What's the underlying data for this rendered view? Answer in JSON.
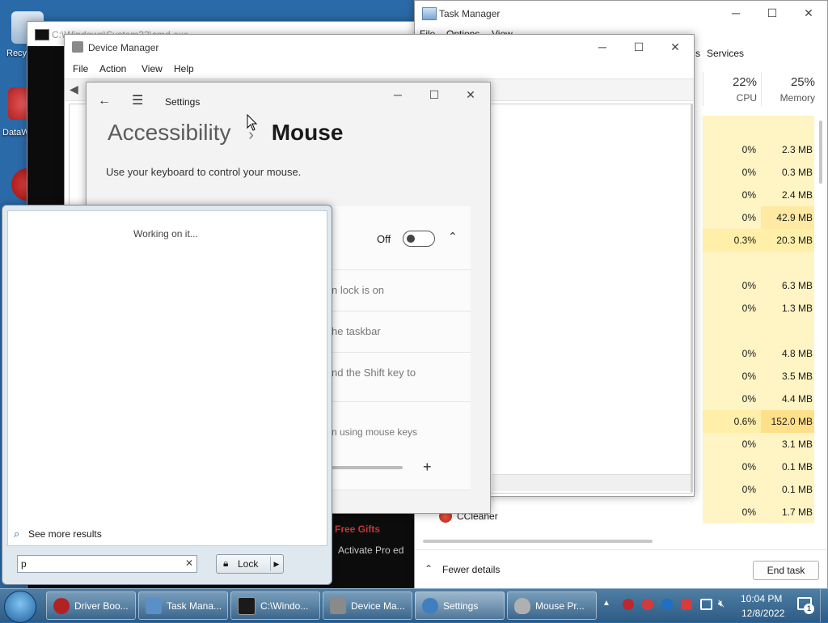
{
  "desktop": {
    "icons": [
      {
        "label": "Recy"
      },
      {
        "label": "DataW"
      }
    ]
  },
  "cmd": {
    "title": "C:\\Windows\\System32\\cmd.exe"
  },
  "taskmgr": {
    "title": "Task Manager",
    "menu": [
      "File",
      "Options",
      "View"
    ],
    "tab_services": "Services",
    "tab_partial": "s",
    "cpu_pct": "22%",
    "cpu_label": "CPU",
    "mem_pct": "25%",
    "mem_label": "Memory",
    "rows": [
      {
        "cpu": "",
        "mem": ""
      },
      {
        "cpu": "0%",
        "mem": "2.3 MB"
      },
      {
        "cpu": "0%",
        "mem": "0.3 MB"
      },
      {
        "cpu": "0%",
        "mem": "2.4 MB"
      },
      {
        "cpu": "0%",
        "mem": "42.9 MB"
      },
      {
        "cpu": "0.3%",
        "mem": "20.3 MB"
      },
      {
        "cpu": "",
        "mem": ""
      },
      {
        "cpu": "0%",
        "mem": "6.3 MB"
      },
      {
        "cpu": "0%",
        "mem": "1.3 MB"
      },
      {
        "cpu": "",
        "mem": ""
      },
      {
        "cpu": "0%",
        "mem": "4.8 MB"
      },
      {
        "cpu": "0%",
        "mem": "3.5 MB"
      },
      {
        "cpu": "0%",
        "mem": "4.4 MB"
      },
      {
        "cpu": "0.6%",
        "mem": "152.0 MB"
      },
      {
        "cpu": "0%",
        "mem": "3.1 MB"
      },
      {
        "cpu": "0%",
        "mem": "0.1 MB"
      },
      {
        "cpu": "0%",
        "mem": "0.1 MB"
      },
      {
        "cpu": "0%",
        "mem": "1.7 MB"
      }
    ],
    "ccleaner_label": "CCleaner",
    "fewer_details": "Fewer details",
    "end_task": "End task"
  },
  "devmgr": {
    "title": "Device Manager",
    "menu": [
      "File",
      "Action",
      "View",
      "Help"
    ]
  },
  "settings": {
    "title": "Settings",
    "breadcrumb_parent": "Accessibility",
    "breadcrumb_sep": "›",
    "page_title": "Mouse",
    "description": "Use your keyboard to control your mouse.",
    "toggle_state": "Off",
    "rows": [
      "n lock is on",
      "he taskbar",
      "nd the Shift key to",
      "n using mouse keys"
    ],
    "plus": "+"
  },
  "start": {
    "working": "Working on it...",
    "see_more": "See more results",
    "search_value": "p",
    "lock_label": "Lock"
  },
  "bg_text": {
    "line1": "Free Gifts",
    "line2": "Activate Pro ed"
  },
  "taskbar": {
    "items": [
      {
        "label": "Driver Boo...",
        "color": "#b22222"
      },
      {
        "label": "Task Mana...",
        "color": "#5a8fc7"
      },
      {
        "label": "C:\\Windo...",
        "color": "#1a1a1a"
      },
      {
        "label": "Device Ma...",
        "color": "#8a8a8a"
      },
      {
        "label": "Settings",
        "color": "#3f7fbf"
      },
      {
        "label": "Mouse Pr...",
        "color": "#b0b0b0"
      }
    ],
    "time": "10:04 PM",
    "date": "12/8/2022",
    "notification_count": "1"
  }
}
